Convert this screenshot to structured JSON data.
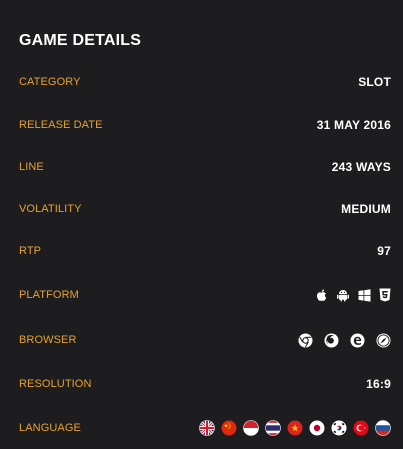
{
  "header": {
    "title": "GAME DETAILS"
  },
  "details": {
    "category": {
      "label": "CATEGORY",
      "value": "SLOT"
    },
    "release": {
      "label": "RELEASE DATE",
      "value": "31 MAY 2016"
    },
    "line": {
      "label": "LINE",
      "value": "243 WAYS"
    },
    "volatility": {
      "label": "VOLATILITY",
      "value": "MEDIUM"
    },
    "rtp": {
      "label": "RTP",
      "value": "97"
    },
    "platform": {
      "label": "PLATFORM",
      "icons": [
        "apple-icon",
        "android-icon",
        "windows-icon",
        "html5-icon"
      ]
    },
    "browser": {
      "label": "BROWSER",
      "icons": [
        "chrome-icon",
        "firefox-icon",
        "edge-icon",
        "safari-icon"
      ]
    },
    "resolution": {
      "label": "RESOLUTION",
      "value": "16:9"
    },
    "language": {
      "label": "LANGUAGE",
      "icons": [
        "uk-flag-icon",
        "china-flag-icon",
        "indonesia-flag-icon",
        "thailand-flag-icon",
        "vietnam-flag-icon",
        "japan-flag-icon",
        "south-korea-flag-icon",
        "turkey-flag-icon",
        "russia-flag-icon"
      ]
    }
  },
  "colors": {
    "accent": "#e8a12c",
    "background": "#1d1d1f",
    "text": "#ffffff"
  }
}
